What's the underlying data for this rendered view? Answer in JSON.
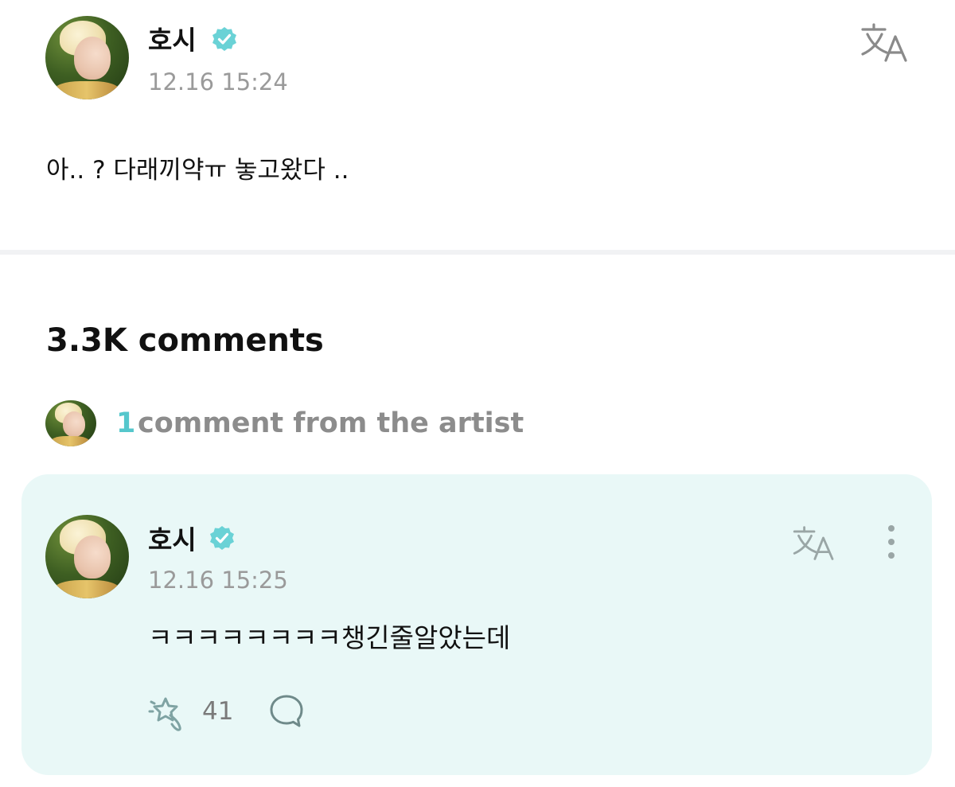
{
  "post": {
    "author": "호시",
    "timestamp": "12.16 15:24",
    "body": "아.. ? 다래끼약ㅠ 놓고왔다 .."
  },
  "comments": {
    "title": "3.3K comments",
    "artist_summary": {
      "count": "1",
      "label": "comment from the artist"
    },
    "artist_comment": {
      "author": "호시",
      "timestamp": "12.16 15:25",
      "body": "ㅋㅋㅋㅋㅋㅋㅋㅋ챙긴줄알았는데",
      "likes": "41"
    }
  },
  "icons": {
    "verified": "verified-badge-icon",
    "translate": "translate-icon",
    "more": "more-vertical-icon",
    "like": "like-icon",
    "reply": "reply-bubble-icon"
  },
  "colors": {
    "accent": "#55c7cc",
    "card_background": "#e9f8f7",
    "muted_text": "#9a9a9a"
  }
}
